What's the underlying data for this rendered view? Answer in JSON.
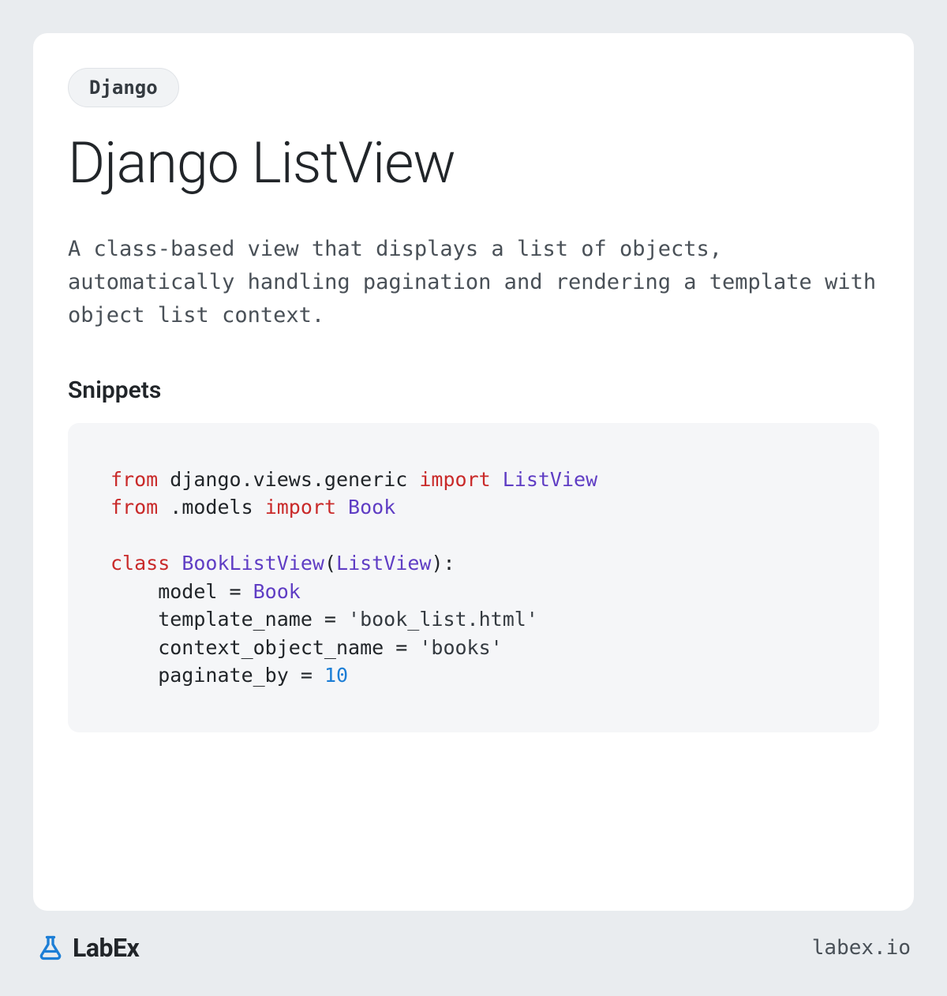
{
  "tag": "Django",
  "title": "Django ListView",
  "description": "A class-based view that displays a list of objects, automatically handling pagination and rendering a template with object list context.",
  "section_heading": "Snippets",
  "code": {
    "line1_from": "from",
    "line1_mod": " django.views.generic ",
    "line1_import": "import",
    "line1_name": " ListView",
    "line2_from": "from",
    "line2_mod": " .models ",
    "line2_import": "import",
    "line2_name": " Book",
    "line4_class_kw": "class",
    "line4_space": " ",
    "line4_classname": "BookListView",
    "line4_open": "(",
    "line4_base": "ListView",
    "line4_close": "):",
    "line5": "    model = ",
    "line5_val": "Book",
    "line6": "    template_name = ",
    "line6_val": "'book_list.html'",
    "line7": "    context_object_name = ",
    "line7_val": "'books'",
    "line8": "    paginate_by = ",
    "line8_val": "10"
  },
  "footer": {
    "brand": "LabEx",
    "site": "labex.io"
  }
}
